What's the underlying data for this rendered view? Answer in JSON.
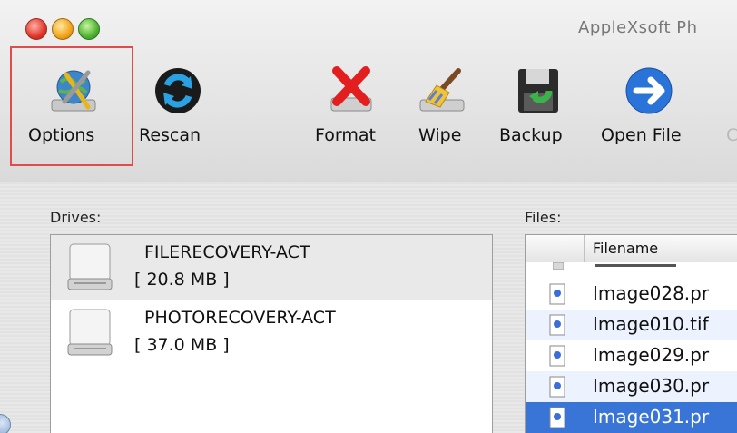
{
  "window": {
    "title": "AppleXsoft Ph"
  },
  "toolbar": {
    "buttons": [
      {
        "id": "options",
        "label": "Options",
        "icon": "options-globe-wrench-icon"
      },
      {
        "id": "rescan",
        "label": "Rescan",
        "icon": "rescan-arrows-icon"
      },
      {
        "id": "format",
        "label": "Format",
        "icon": "format-drive-x-icon"
      },
      {
        "id": "wipe",
        "label": "Wipe",
        "icon": "wipe-brush-icon"
      },
      {
        "id": "backup",
        "label": "Backup",
        "icon": "backup-floppy-icon"
      },
      {
        "id": "open_file",
        "label": "Open File",
        "icon": "open-file-arrow-icon"
      }
    ],
    "cut_off_label": "C"
  },
  "drives": {
    "label": "Drives:",
    "items": [
      {
        "name": "FILERECOVERY-ACT",
        "size": "[ 20.8 MB ]",
        "selected": true
      },
      {
        "name": "PHOTORECOVERY-ACT",
        "size": "[ 37.0 MB ]",
        "selected": false
      }
    ]
  },
  "files": {
    "label": "Files:",
    "column_header": "Filename",
    "rows": [
      {
        "name": "Image028.pr"
      },
      {
        "name": "Image010.tif"
      },
      {
        "name": "Image029.pr"
      },
      {
        "name": "Image030.pr"
      },
      {
        "name": "Image031.pr"
      }
    ]
  },
  "colors": {
    "highlight_border": "#e24b4b",
    "selection": "#3875d7",
    "alt_row": "#edf3fe"
  }
}
